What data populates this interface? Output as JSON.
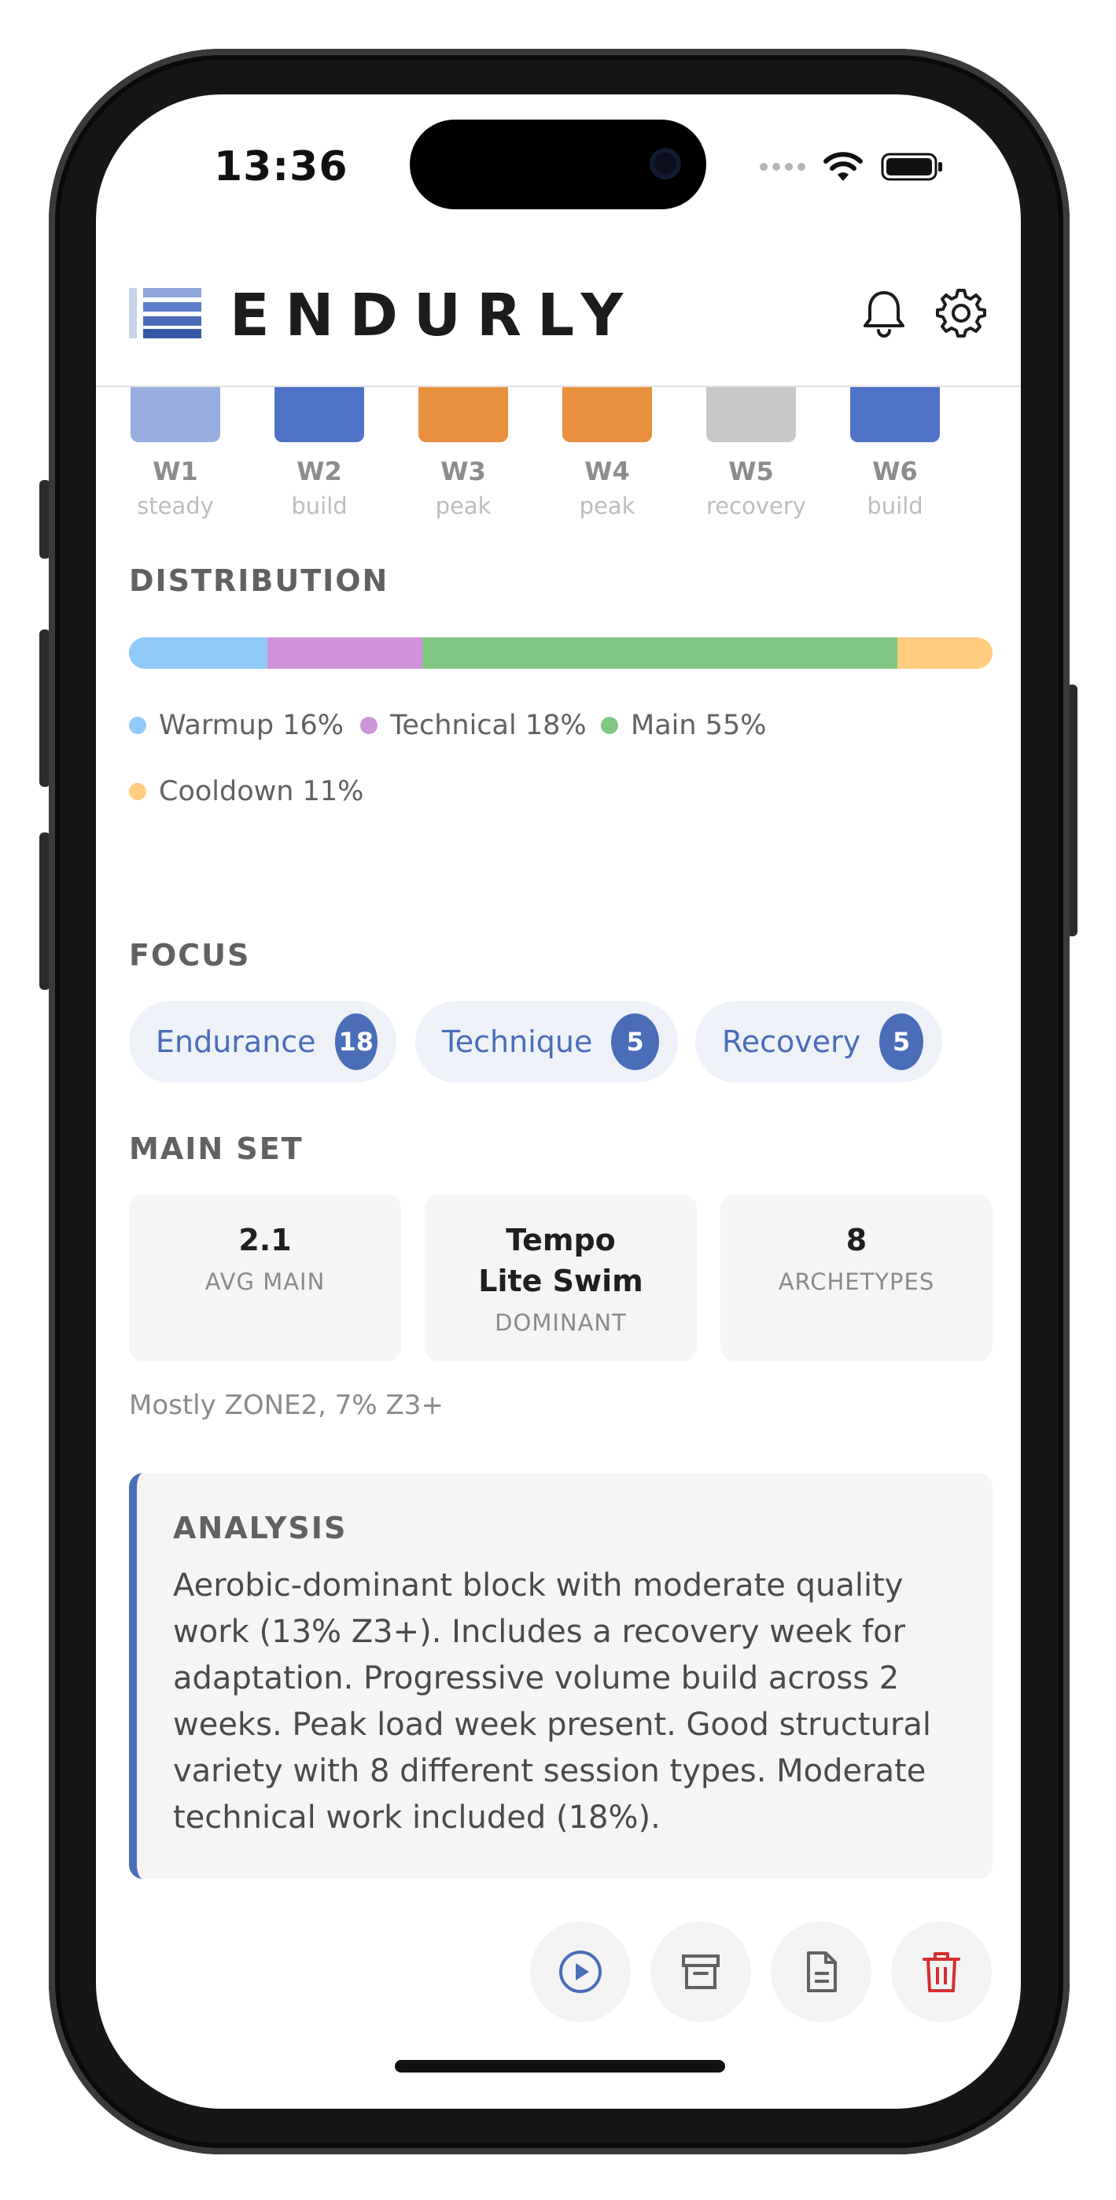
{
  "status": {
    "time": "13:36"
  },
  "header": {
    "brand": "ENDURLY"
  },
  "weeks": [
    {
      "label": "W1",
      "phase": "steady",
      "color": "#98aedf"
    },
    {
      "label": "W2",
      "phase": "build",
      "color": "#4e73c6"
    },
    {
      "label": "W3",
      "phase": "peak",
      "color": "#e8903e"
    },
    {
      "label": "W4",
      "phase": "peak",
      "color": "#e8903e"
    },
    {
      "label": "W5",
      "phase": "recovery",
      "color": "#c8c8c8"
    },
    {
      "label": "W6",
      "phase": "build",
      "color": "#4e73c6"
    }
  ],
  "distribution": {
    "title": "DISTRIBUTION",
    "segments": [
      {
        "label": "Warmup 16%",
        "percent": 16,
        "color": "#90caf9"
      },
      {
        "label": "Technical 18%",
        "percent": 18,
        "color": "#ce93d8"
      },
      {
        "label": "Main 55%",
        "percent": 55,
        "color": "#81c784"
      },
      {
        "label": "Cooldown 11%",
        "percent": 11,
        "color": "#ffcc80"
      }
    ]
  },
  "focus": {
    "title": "FOCUS",
    "chips": [
      {
        "label": "Endurance",
        "count": "18"
      },
      {
        "label": "Technique",
        "count": "5"
      },
      {
        "label": "Recovery",
        "count": "5"
      }
    ]
  },
  "main_set": {
    "title": "MAIN SET",
    "stats": [
      {
        "value": "2.1",
        "label": "AVG MAIN"
      },
      {
        "value": "Tempo Lite Swim",
        "label": "DOMINANT"
      },
      {
        "value": "8",
        "label": "ARCHETYPES"
      }
    ],
    "note": "Mostly ZONE2, 7% Z3+"
  },
  "analysis": {
    "title": "ANALYSIS",
    "body": "Aerobic-dominant block with moderate quality work (13% Z3+). Includes a recovery week for adaptation. Progressive volume build across 2 weeks. Peak load week present. Good structural variety with 8 different session types. Moderate technical work included (18%)."
  },
  "actions": [
    {
      "name": "play-icon",
      "color": "#4a6db8"
    },
    {
      "name": "archive-icon",
      "color": "#616161"
    },
    {
      "name": "document-icon",
      "color": "#616161"
    },
    {
      "name": "trash-icon",
      "color": "#d32f2f"
    }
  ],
  "colors": {
    "accent": "#4a6db8",
    "danger": "#d32f2f"
  }
}
